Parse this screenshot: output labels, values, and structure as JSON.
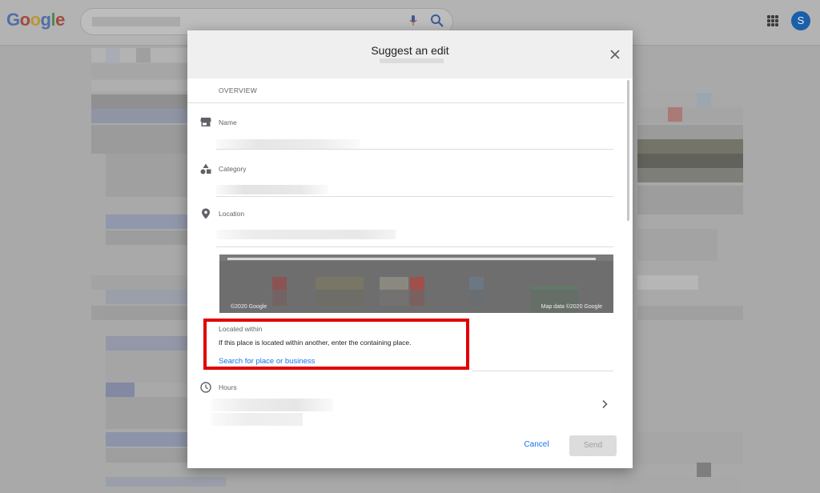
{
  "header": {
    "logo_letters": [
      "G",
      "o",
      "o",
      "g",
      "l",
      "e"
    ],
    "avatar_initial": "S",
    "apps_icon": "apps-grid-icon",
    "mic_icon": "microphone-icon",
    "search_icon": "search-icon"
  },
  "dialog": {
    "title": "Suggest an edit",
    "close_icon": "close-icon",
    "overview_heading": "OVERVIEW",
    "fields": {
      "name_label": "Name",
      "category_label": "Category",
      "location_label": "Location",
      "hours_label": "Hours"
    },
    "map": {
      "attribution_left": "©2020 Google",
      "attribution_right": "Map data ©2020 Google"
    },
    "located_within": {
      "title": "Located within",
      "description": "If this place is located within another, enter the containing place.",
      "link": "Search for place or business"
    },
    "buttons": {
      "cancel": "Cancel",
      "send": "Send"
    }
  },
  "colors": {
    "accent_blue": "#1a73e8",
    "highlight_red": "#e00000",
    "overlay_gray": "#a9a9a9"
  }
}
